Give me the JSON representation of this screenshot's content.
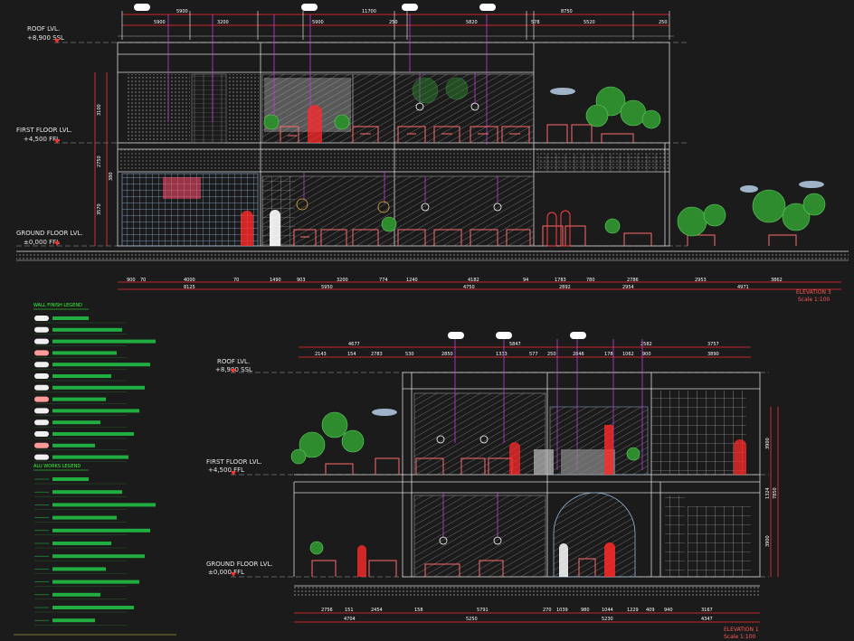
{
  "elevation_top": {
    "levels": {
      "roof": {
        "name": "ROOF LVL.",
        "value": "+8,900 SSL"
      },
      "first": {
        "name": "FIRST FLOOR LVL.",
        "value": "+4,500 FFL"
      },
      "ground": {
        "name": "GROUND FLOOR LVL.",
        "value": "±0,000 FFL"
      }
    },
    "dims_top_overall": [
      "5900",
      "11700",
      "8750"
    ],
    "dims_top_parts": [
      "5900",
      "3200",
      "5900",
      "250",
      "5820",
      "578",
      "5520",
      "250"
    ],
    "dims_bottom_parts": [
      "900",
      "70",
      "4000",
      "70",
      "1490",
      "903",
      "3200",
      "774",
      "1240",
      "4182",
      "94",
      "1783",
      "780",
      "2786",
      "2953",
      "3862"
    ],
    "dims_bottom_totals": [
      "8125",
      "5950",
      "4750",
      "2892",
      "2954",
      "4971"
    ],
    "dims_left": [
      "3100",
      "2750",
      "380",
      "3570"
    ],
    "title": "ELEVATION 3",
    "scale": "Scale 1:100"
  },
  "elevation_bottom": {
    "levels": {
      "roof": {
        "name": "ROOF LVL.",
        "value": "+8,900 SSL"
      },
      "first": {
        "name": "FIRST FLOOR LVL.",
        "value": "+4,500 FFL"
      },
      "ground": {
        "name": "GROUND FLOOR LVL.",
        "value": "±0,000 FFL"
      }
    },
    "dims_top_overall": [
      "4677",
      "5847",
      "2582",
      "3757"
    ],
    "dims_top_parts": [
      "2143",
      "154",
      "2783",
      "530",
      "2850",
      "1333",
      "577",
      "250",
      "2846",
      "178",
      "1062",
      "900",
      "3890"
    ],
    "dims_bottom_parts": [
      "2756",
      "151",
      "2454",
      "158",
      "5791",
      "270",
      "1039",
      "980",
      "1044",
      "1229",
      "409",
      "940",
      "3167"
    ],
    "dims_bottom_totals": [
      "4704",
      "5250",
      "5230",
      "4347"
    ],
    "dims_right": [
      "3900",
      "1324",
      "7850",
      "3900"
    ],
    "title": "ELEVATION 1",
    "scale": "Scale 1:100"
  },
  "legends": {
    "wall_finish": {
      "title": "WALL FINISH LEGEND",
      "count": 13
    },
    "aluminium": {
      "title": "ALU WORKS LEGEND",
      "count": 12
    }
  },
  "colors": {
    "background": "#1b1b1b",
    "linework": "#d9d9d9",
    "dimension": "#ff3030",
    "furniture": "#ff6b6b",
    "glazing": "#a9d8ff",
    "pendant": "#c13dd6",
    "planting": "#2e8b2e",
    "legend": "#1fae3f"
  }
}
